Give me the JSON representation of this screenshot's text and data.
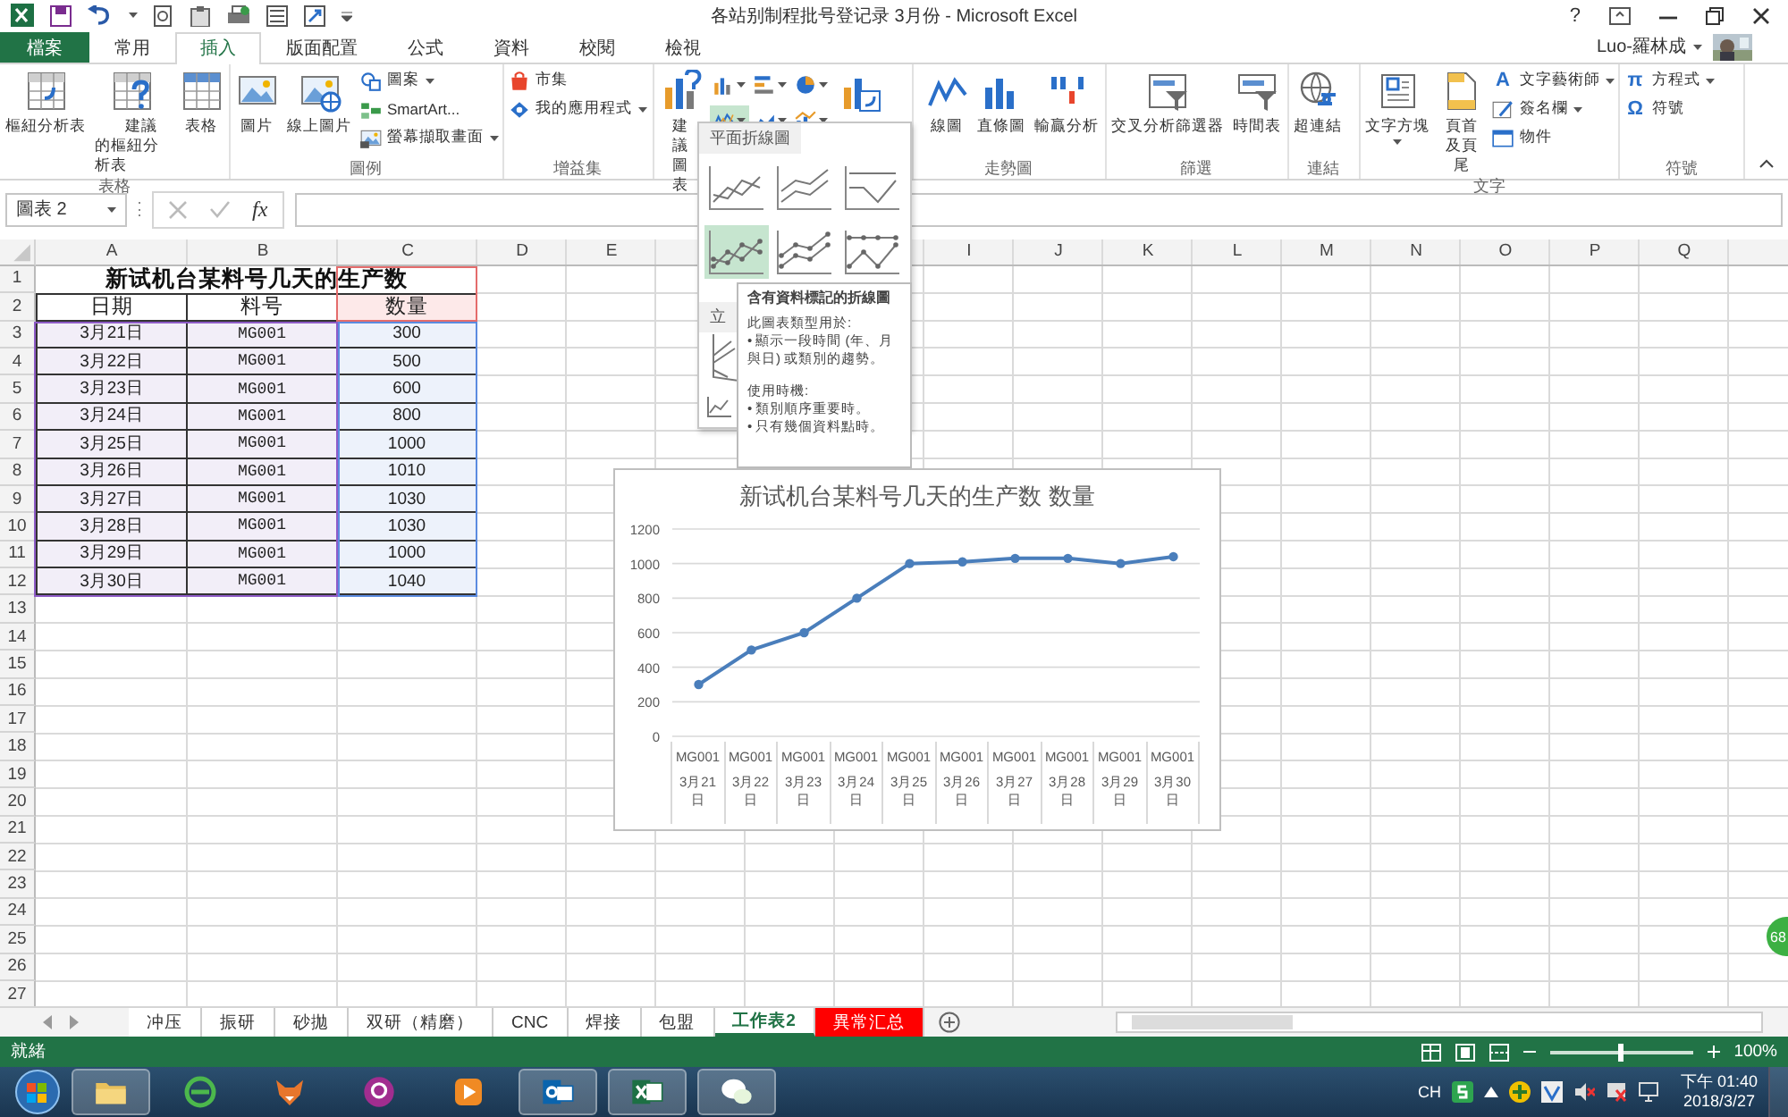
{
  "title_bar": {
    "title": "各站别制程批号登记录 3月份 - Microsoft Excel",
    "help": "?"
  },
  "tabs": [
    {
      "label": "檔案",
      "kind": "file",
      "selected": false
    },
    {
      "label": "常用",
      "kind": "tab",
      "selected": false
    },
    {
      "label": "插入",
      "kind": "tab",
      "selected": true
    },
    {
      "label": "版面配置",
      "kind": "tab",
      "selected": false
    },
    {
      "label": "公式",
      "kind": "tab",
      "selected": false
    },
    {
      "label": "資料",
      "kind": "tab",
      "selected": false
    },
    {
      "label": "校閱",
      "kind": "tab",
      "selected": false
    },
    {
      "label": "檢視",
      "kind": "tab",
      "selected": false
    }
  ],
  "user": {
    "name": "Luo-羅林成"
  },
  "ribbon": {
    "groups": [
      {
        "label": "表格",
        "items": [
          {
            "kind": "large",
            "label": "樞紐分析表",
            "dropdown": false
          },
          {
            "kind": "large",
            "label": "建議的樞紐分析表",
            "dropdown": false
          },
          {
            "kind": "large",
            "label": "表格",
            "dropdown": false
          }
        ]
      },
      {
        "label": "圖例",
        "items": [
          {
            "kind": "large",
            "label": "圖片",
            "dropdown": false
          },
          {
            "kind": "large",
            "label": "線上圖片",
            "dropdown": false
          },
          {
            "kind": "stack",
            "items": [
              {
                "label": "圖案",
                "dropdown": true
              },
              {
                "label": "SmartArt...",
                "dropdown": false
              },
              {
                "label": "螢幕擷取畫面",
                "dropdown": true
              }
            ]
          }
        ]
      },
      {
        "label": "增益集",
        "items": [
          {
            "kind": "stack",
            "items": [
              {
                "label": "市集",
                "dropdown": false
              },
              {
                "label": "我的應用程式",
                "dropdown": true
              }
            ]
          }
        ]
      },
      {
        "items": [
          {
            "kind": "large",
            "label": "建議圖表",
            "dropdown": false
          },
          {
            "kind": "grid",
            "items": [
              {
                "selected": false
              },
              {
                "selected": false
              },
              {
                "selected": false
              },
              {
                "selected": true
              },
              {
                "selected": false
              },
              {
                "selected": false
              }
            ]
          },
          {
            "kind": "large",
            "dropdown": false
          }
        ]
      },
      {
        "label": "走勢圖",
        "items": [
          {
            "kind": "large",
            "label": "線圖",
            "dropdown": false
          },
          {
            "kind": "large",
            "label": "直條圖",
            "dropdown": false
          },
          {
            "kind": "large",
            "label": "輸贏分析",
            "dropdown": false
          }
        ]
      },
      {
        "label": "篩選",
        "items": [
          {
            "kind": "large",
            "label": "交叉分析篩選器",
            "dropdown": false
          },
          {
            "kind": "large",
            "label": "時間表",
            "dropdown": false
          }
        ]
      },
      {
        "label": "連結",
        "items": [
          {
            "kind": "large",
            "label": "超連結",
            "dropdown": false
          }
        ]
      },
      {
        "label": "文字",
        "items": [
          {
            "kind": "large",
            "label": "文字方塊",
            "dropdown": true
          },
          {
            "kind": "large",
            "label": "頁首及頁尾",
            "dropdown": false
          },
          {
            "kind": "stack",
            "items": [
              {
                "label": "文字藝術師",
                "dropdown": true,
                "glyph": "A"
              },
              {
                "label": "簽名欄",
                "dropdown": true
              },
              {
                "label": "物件",
                "dropdown": false
              }
            ]
          }
        ]
      },
      {
        "label": "符號",
        "items": [
          {
            "kind": "stack",
            "items": [
              {
                "label": "方程式",
                "dropdown": true,
                "glyph": "π"
              },
              {
                "label": "符號",
                "dropdown": false,
                "glyph": "Ω"
              }
            ]
          }
        ]
      }
    ]
  },
  "formula_bar": {
    "name_box": "圖表 2",
    "function_label": "fx"
  },
  "sheet": {
    "columns": [
      {
        "label": "A"
      },
      {
        "label": "B"
      },
      {
        "label": "C"
      },
      {
        "label": "D"
      },
      {
        "label": "E"
      },
      {},
      {},
      {},
      {
        "label": "I"
      },
      {
        "label": "J"
      },
      {
        "label": "K"
      },
      {
        "label": "L"
      },
      {
        "label": "M"
      },
      {
        "label": "N"
      },
      {
        "label": "O"
      },
      {
        "label": "P"
      },
      {
        "label": "Q"
      }
    ],
    "chart_source_highlighted": true,
    "title_row": {
      "number": "1",
      "text": "新试机台某料号几天的生产数"
    },
    "header_row": {
      "number": "2",
      "cells": [
        "日期",
        "料号",
        "数量"
      ]
    },
    "data_rows": [
      {
        "number": "3",
        "cells": [
          "3月21日",
          "MG001",
          "300"
        ]
      },
      {
        "number": "4",
        "cells": [
          "3月22日",
          "MG001",
          "500"
        ]
      },
      {
        "number": "5",
        "cells": [
          "3月23日",
          "MG001",
          "600"
        ]
      },
      {
        "number": "6",
        "cells": [
          "3月24日",
          "MG001",
          "800"
        ]
      },
      {
        "number": "7",
        "cells": [
          "3月25日",
          "MG001",
          "1000"
        ]
      },
      {
        "number": "8",
        "cells": [
          "3月26日",
          "MG001",
          "1010"
        ]
      },
      {
        "number": "9",
        "cells": [
          "3月27日",
          "MG001",
          "1030"
        ]
      },
      {
        "number": "10",
        "cells": [
          "3月28日",
          "MG001",
          "1030"
        ]
      },
      {
        "number": "11",
        "cells": [
          "3月29日",
          "MG001",
          "1000"
        ]
      },
      {
        "number": "12",
        "cells": [
          "3月30日",
          "MG001",
          "1040"
        ]
      }
    ],
    "empty_rows": [
      "13",
      "14",
      "15",
      "16",
      "17",
      "18",
      "19",
      "20",
      "21",
      "22",
      "23",
      "24",
      "25",
      "26",
      "27"
    ]
  },
  "chart": {
    "chart_data": {
      "type": "line",
      "title": "新试机台某料号几天的生产数 数量",
      "categories": [
        "3月21日",
        "3月22日",
        "3月23日",
        "3月24日",
        "3月25日",
        "3月26日",
        "3月27日",
        "3月28日",
        "3月29日",
        "3月30日"
      ],
      "series": [
        {
          "color": "#4a7ebb",
          "marker": true,
          "values": [
            300,
            500,
            600,
            800,
            1000,
            1010,
            1030,
            1030,
            1000,
            1040
          ]
        }
      ],
      "ylim": [
        0,
        1200
      ],
      "yticks": [
        0,
        200,
        400,
        600,
        800,
        1000,
        1200
      ],
      "grid": true
    },
    "category_items": [
      "MG001",
      "MG001",
      "MG001",
      "MG001",
      "MG001",
      "MG001",
      "MG001",
      "MG001",
      "MG001",
      "MG001"
    ]
  },
  "gallery": {
    "section_title": "平面折線圖",
    "thumbs": [
      {
        "selected": false
      },
      {
        "selected": false
      },
      {
        "selected": false
      },
      {
        "selected": true
      },
      {
        "selected": false
      },
      {
        "selected": false
      }
    ],
    "section2_title": "立"
  },
  "tooltip": {
    "title": "含有資料標記的折線圖",
    "lines": [
      "此圖表類型用於:",
      "• 顯示一段時間 (年、月與日) 或類別的趨勢。",
      "使用時機:",
      "• 類別順序重要時。",
      "• 只有幾個資料點時。"
    ]
  },
  "floating_badge": "68",
  "sheet_tabs": [
    {
      "label": "冲压",
      "selected": false,
      "color": "#ffffff"
    },
    {
      "label": "振研",
      "selected": false,
      "color": "#ffffff"
    },
    {
      "label": "砂拋",
      "selected": false,
      "color": "#ffffff"
    },
    {
      "label": "双研（精磨）",
      "selected": false,
      "color": "#ffffff"
    },
    {
      "label": "CNC",
      "selected": false,
      "color": "#ffffff"
    },
    {
      "label": "焊接",
      "selected": false,
      "color": "#ffffff"
    },
    {
      "label": "包盟",
      "selected": false,
      "color": "#ffffff"
    },
    {
      "label": "工作表2",
      "selected": true,
      "color": "#ffffff"
    },
    {
      "label": "異常汇总",
      "selected": false,
      "color": "#ff0000"
    }
  ],
  "status_bar": {
    "status": "就緒",
    "zoom": "100%",
    "zoom_level": {
      "level": 0.5
    }
  },
  "taskbar": {
    "apps": [
      {
        "running": true
      },
      {
        "running": false
      },
      {
        "running": false
      },
      {
        "running": false
      },
      {
        "running": false
      },
      {
        "running": true
      },
      {
        "running": true
      },
      {
        "running": true
      }
    ],
    "language": "CH",
    "time": "下午 01:40",
    "date": "2018/3/27"
  }
}
